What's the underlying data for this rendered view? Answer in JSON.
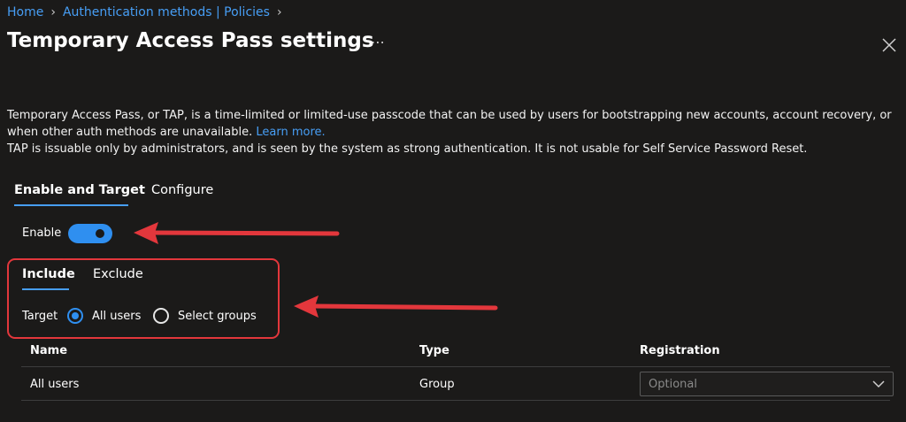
{
  "breadcrumb": {
    "items": [
      {
        "label": "Home"
      },
      {
        "label": "Authentication methods | Policies"
      }
    ]
  },
  "page": {
    "title": "Temporary Access Pass settings",
    "more_icon": "ellipsis-icon",
    "close_icon": "close-icon"
  },
  "description": {
    "line1": "Temporary Access Pass, or TAP, is a time-limited or limited-use passcode that can be used by users for bootstrapping new accounts, account recovery, or",
    "line2": "when other auth methods are unavailable.",
    "learn_more": "Learn more.",
    "line3": "TAP is issuable only by administrators, and is seen by the system as strong authentication. It is not usable for Self Service Password Reset."
  },
  "tabs": {
    "items": [
      {
        "label": "Enable and Target",
        "active": true
      },
      {
        "label": "Configure",
        "active": false
      }
    ]
  },
  "enable": {
    "label": "Enable",
    "on": true
  },
  "scope_tabs": {
    "items": [
      {
        "label": "Include",
        "active": true
      },
      {
        "label": "Exclude",
        "active": false
      }
    ]
  },
  "target": {
    "label": "Target",
    "options": [
      {
        "label": "All users",
        "checked": true
      },
      {
        "label": "Select groups",
        "checked": false
      }
    ]
  },
  "table": {
    "columns": [
      "Name",
      "Type",
      "Registration"
    ],
    "rows": [
      {
        "name": "All users",
        "type": "Group",
        "registration": "Optional"
      }
    ]
  },
  "colors": {
    "background": "#1b1a19",
    "accent": "#2f8ff0",
    "link": "#479ef5",
    "annotation": "#e3373c"
  }
}
